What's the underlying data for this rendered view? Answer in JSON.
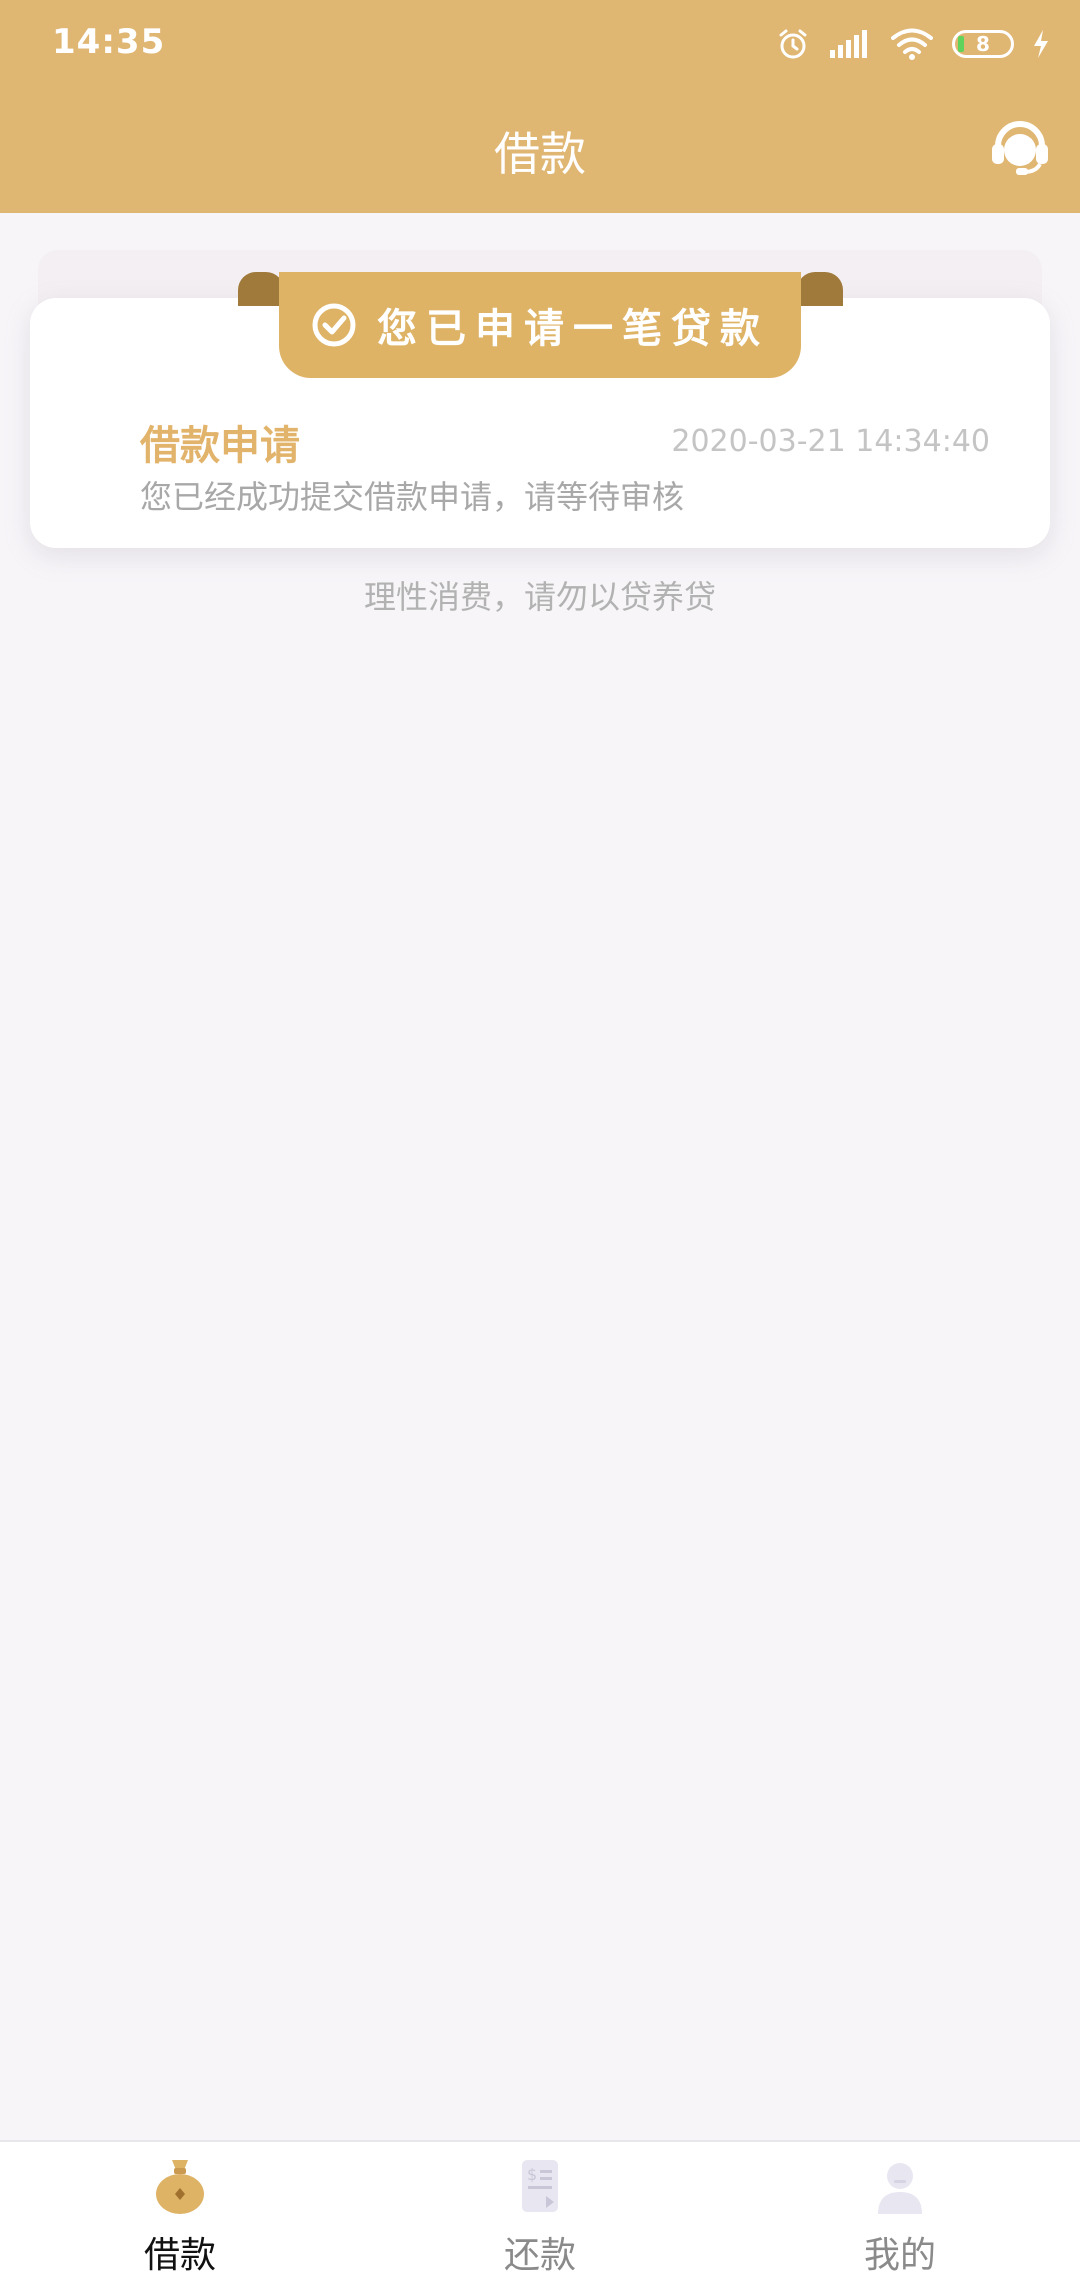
{
  "status_bar": {
    "time": "14:35",
    "battery_level": "8"
  },
  "header": {
    "title": "借款",
    "support_icon": "headset-icon"
  },
  "card": {
    "banner_text": "您已申请一笔贷款",
    "banner_icon": "check-circle-icon",
    "title": "借款申请",
    "timestamp": "2020-03-21 14:34:40",
    "description": "您已经成功提交借款申请，请等待审核"
  },
  "notice": "理性消费，请勿以贷养贷",
  "bottom_nav": {
    "items": [
      {
        "label": "借款",
        "icon": "money-bag-icon",
        "active": true
      },
      {
        "label": "还款",
        "icon": "bill-icon",
        "active": false
      },
      {
        "label": "我的",
        "icon": "person-icon",
        "active": false
      }
    ]
  },
  "colors": {
    "primary": "#e0b673",
    "ribbon": "#deb366",
    "title_gold": "#e2b36a",
    "background": "#f7f5f8"
  }
}
